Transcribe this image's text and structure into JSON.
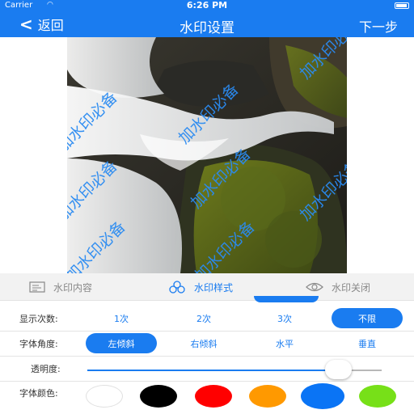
{
  "status_bar": {
    "carrier": "Carrier",
    "wifi_icon": "wifi-icon",
    "time": "6:26 PM",
    "battery_icon": "battery-icon"
  },
  "nav": {
    "back_label": "返回",
    "title": "水印设置",
    "next_label": "下一步"
  },
  "watermark": {
    "text": "加水印必备",
    "color": "#2a8bf2"
  },
  "tabs": [
    {
      "label": "水印内容",
      "icon": "text-doc-icon",
      "active": false
    },
    {
      "label": "水印样式",
      "icon": "style-circles-icon",
      "active": true
    },
    {
      "label": "水印关闭",
      "icon": "eye-icon",
      "active": false
    }
  ],
  "display_count": {
    "label": "显示次数:",
    "options": [
      "1次",
      "2次",
      "3次",
      "不限"
    ],
    "selected": "不限"
  },
  "font_angle": {
    "label": "字体角度:",
    "options": [
      "左倾斜",
      "右倾斜",
      "水平",
      "垂直"
    ],
    "selected": "左倾斜"
  },
  "opacity": {
    "label": "透明度:",
    "value": 0.85
  },
  "font_color": {
    "label": "字体颜色:",
    "colors": [
      "#ffffff",
      "#000000",
      "#ff0000",
      "#ff9900",
      "#0a74f5",
      "#77e018"
    ]
  }
}
